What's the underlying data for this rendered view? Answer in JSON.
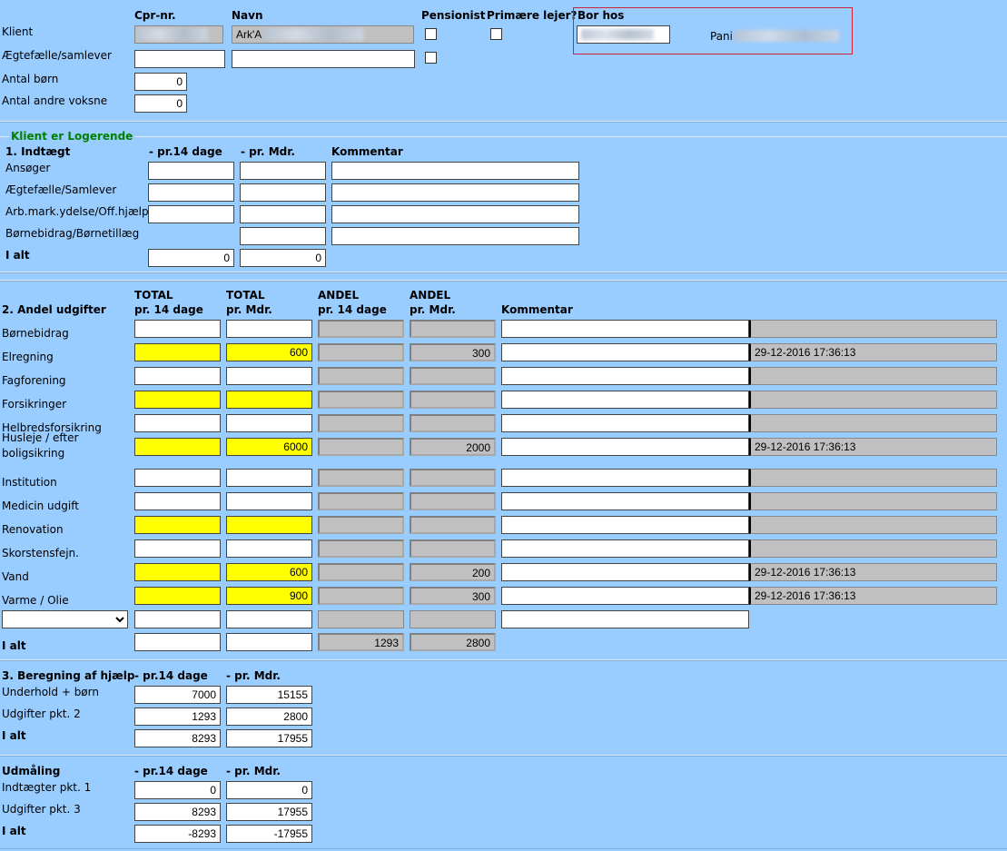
{
  "client": {
    "headers": {
      "cpr": "Cpr-nr.",
      "navn": "Navn",
      "pensionist": "Pensionist",
      "primaere": "Primære lejer?",
      "borhos": "Bor hos"
    },
    "rows": {
      "klient": "Klient",
      "aegtefaelle": "Ægtefælle/samlever",
      "antal_born": "Antal børn",
      "antal_voksne": "Antal andre voksne"
    },
    "navn_prefix": "Ark'A",
    "antal_born": "0",
    "antal_voksne": "0",
    "borhos_name_prefix": "Pani"
  },
  "logerende": {
    "title": "Klient er Logerende",
    "heading": "1. Indtægt",
    "col14": "- pr.14 dage",
    "colmdr": "- pr. Mdr.",
    "colkom": "Kommentar",
    "rows": [
      "Ansøger",
      "Ægtefælle/Samlever",
      "Arb.mark.ydelse/Off.hjælp",
      "Børnebidrag/Børnetillæg"
    ],
    "total_label": "I alt",
    "total_14": "0",
    "total_mdr": "0"
  },
  "udgifter": {
    "heading": "2. Andel udgifter",
    "h1a": "TOTAL",
    "h1b": "pr. 14 dage",
    "h2a": "TOTAL",
    "h2b": "pr. Mdr.",
    "h3a": "ANDEL",
    "h3b": "pr. 14 dage",
    "h4a": "ANDEL",
    "h4b": "pr. Mdr.",
    "h5": "Kommentar",
    "rows": [
      {
        "label": "Børnebidrag",
        "yellow": false,
        "t14": "",
        "tmdr": "",
        "a14": "",
        "amdr": "",
        "kom": "",
        "stamp": ""
      },
      {
        "label": "Elregning",
        "yellow": true,
        "t14": "",
        "tmdr": "600",
        "a14": "",
        "amdr": "300",
        "kom": "",
        "stamp": "29-12-2016 17:36:13"
      },
      {
        "label": "Fagforening",
        "yellow": false,
        "t14": "",
        "tmdr": "",
        "a14": "",
        "amdr": "",
        "kom": "",
        "stamp": ""
      },
      {
        "label": "Forsikringer",
        "yellow": true,
        "t14": "",
        "tmdr": "",
        "a14": "",
        "amdr": "",
        "kom": "",
        "stamp": ""
      },
      {
        "label": "Helbredsforsikring",
        "yellow": false,
        "t14": "",
        "tmdr": "",
        "a14": "",
        "amdr": "",
        "kom": "",
        "stamp": ""
      },
      {
        "label": "Husleje / efter",
        "label2": "boligsikring",
        "yellow": true,
        "t14": "",
        "tmdr": "6000",
        "a14": "",
        "amdr": "2000",
        "kom": "",
        "stamp": "29-12-2016 17:36:13"
      },
      {
        "label": "Institution",
        "yellow": false,
        "t14": "",
        "tmdr": "",
        "a14": "",
        "amdr": "",
        "kom": "",
        "stamp": ""
      },
      {
        "label": "Medicin udgift",
        "yellow": false,
        "t14": "",
        "tmdr": "",
        "a14": "",
        "amdr": "",
        "kom": "",
        "stamp": ""
      },
      {
        "label": "Renovation",
        "yellow": true,
        "t14": "",
        "tmdr": "",
        "a14": "",
        "amdr": "",
        "kom": "",
        "stamp": ""
      },
      {
        "label": "Skorstensfejn.",
        "yellow": false,
        "t14": "",
        "tmdr": "",
        "a14": "",
        "amdr": "",
        "kom": "",
        "stamp": ""
      },
      {
        "label": "Vand",
        "yellow": true,
        "t14": "",
        "tmdr": "600",
        "a14": "",
        "amdr": "200",
        "kom": "",
        "stamp": "29-12-2016 17:36:13"
      },
      {
        "label": "Varme / Olie",
        "yellow": true,
        "t14": "",
        "tmdr": "900",
        "a14": "",
        "amdr": "300",
        "kom": "",
        "stamp": "29-12-2016 17:36:13"
      }
    ],
    "select_value": "",
    "total_label": "I alt",
    "total_a14": "1293",
    "total_amdr": "2800"
  },
  "beregning": {
    "heading": "3. Beregning af hjælp",
    "col14": "- pr.14 dage",
    "colmdr": "- pr. Mdr.",
    "rows": [
      {
        "label": "Underhold + børn",
        "v14": "7000",
        "vmdr": "15155"
      },
      {
        "label": "Udgifter pkt. 2",
        "v14": "1293",
        "vmdr": "2800"
      }
    ],
    "total_label": "I alt",
    "total_14": "8293",
    "total_mdr": "17955"
  },
  "udmaaling": {
    "heading": "Udmåling",
    "col14": "- pr.14 dage",
    "colmdr": "- pr. Mdr.",
    "rows": [
      {
        "label": "Indtægter pkt. 1",
        "v14": "0",
        "vmdr": "0"
      },
      {
        "label": "Udgifter pkt. 3",
        "v14": "8293",
        "vmdr": "17955"
      }
    ],
    "total_label": "I alt",
    "total_14": "-8293",
    "total_mdr": "-17955"
  },
  "colors": {
    "background": "#99ccff",
    "highlight": "#ffff00",
    "readonly": "#c0c0c0",
    "title_green": "#008000",
    "frame_red": "#d02040"
  }
}
